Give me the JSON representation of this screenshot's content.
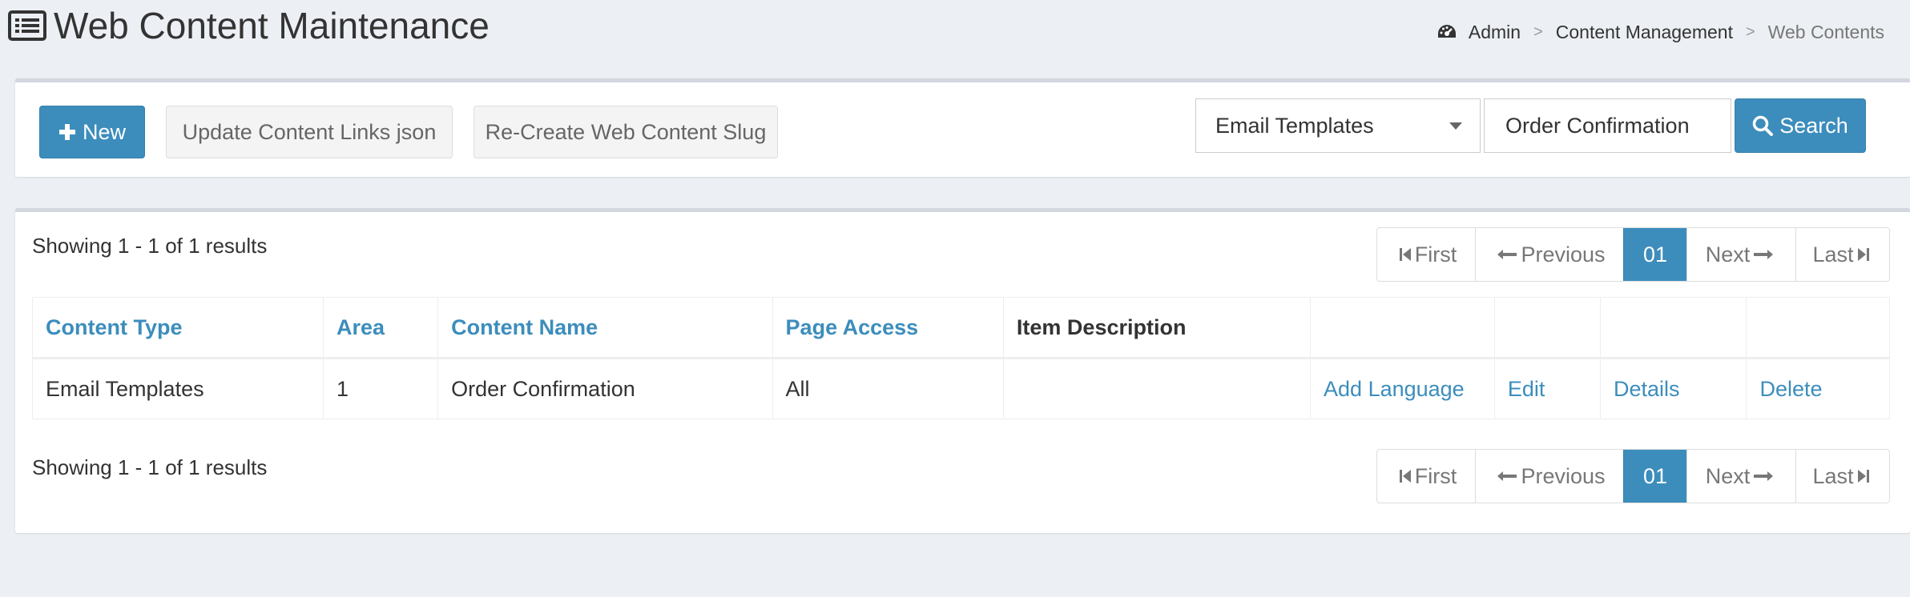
{
  "header": {
    "title": "Web Content Maintenance",
    "title_icon": "list-alt-icon",
    "breadcrumb": {
      "icon": "dashboard-icon",
      "items": [
        "Admin",
        "Content Management",
        "Web Contents"
      ],
      "separator": ">"
    }
  },
  "toolbar": {
    "new_label": "New",
    "update_label": "Update Content Links json",
    "recreate_label": "Re-Create Web Content Slug",
    "category_select": {
      "selected": "Email Templates"
    },
    "search_value": "Order Confirmation",
    "search_label": "Search"
  },
  "results": {
    "summary": "Showing 1 - 1 of 1 results",
    "pager": {
      "first": "First",
      "previous": "Previous",
      "current_page": "01",
      "next": "Next",
      "last": "Last"
    },
    "columns": [
      "Content Type",
      "Area",
      "Content Name",
      "Page Access",
      "Item Description"
    ],
    "rows": [
      {
        "content_type": "Email Templates",
        "area": "1",
        "content_name": "Order Confirmation",
        "page_access": "All",
        "item_description": "",
        "actions": [
          "Add Language",
          "Edit",
          "Details",
          "Delete"
        ]
      }
    ]
  },
  "colors": {
    "primary": "#3c8dbc",
    "background": "#eceff3",
    "box_border": "#d2d6de"
  }
}
